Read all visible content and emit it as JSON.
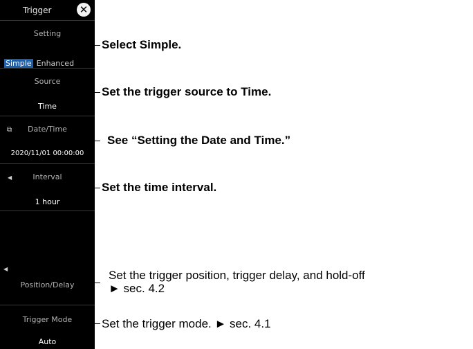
{
  "panel": {
    "title": "Trigger",
    "close_icon": "close-circle-icon",
    "setting": {
      "label": "Setting",
      "options": [
        "Simple",
        "Enhanced"
      ],
      "selected": "Simple"
    },
    "source": {
      "label": "Source",
      "value": "Time"
    },
    "datetime": {
      "label": "Date/Time",
      "value": "2020/11/01 00:00:00",
      "icon": "datetime-icon"
    },
    "interval": {
      "label": "Interval",
      "value": "1 hour"
    },
    "position": {
      "label": "Position/Delay"
    },
    "mode": {
      "label": "Trigger Mode",
      "value": "Auto"
    }
  },
  "notes": {
    "setting": "Select Simple.",
    "source": "Set the trigger source to Time.",
    "datetime": "See “Setting the Date and Time.”",
    "interval": "Set the time interval.",
    "position_line1": "Set the trigger position, trigger delay, and hold-off",
    "position_line2": "► sec. 4.2",
    "mode": "Set the trigger mode. ► sec. 4.1"
  },
  "colors": {
    "panel_bg": "#000000",
    "selected_bg": "#1f5fa8",
    "label": "#b4b4b4"
  }
}
